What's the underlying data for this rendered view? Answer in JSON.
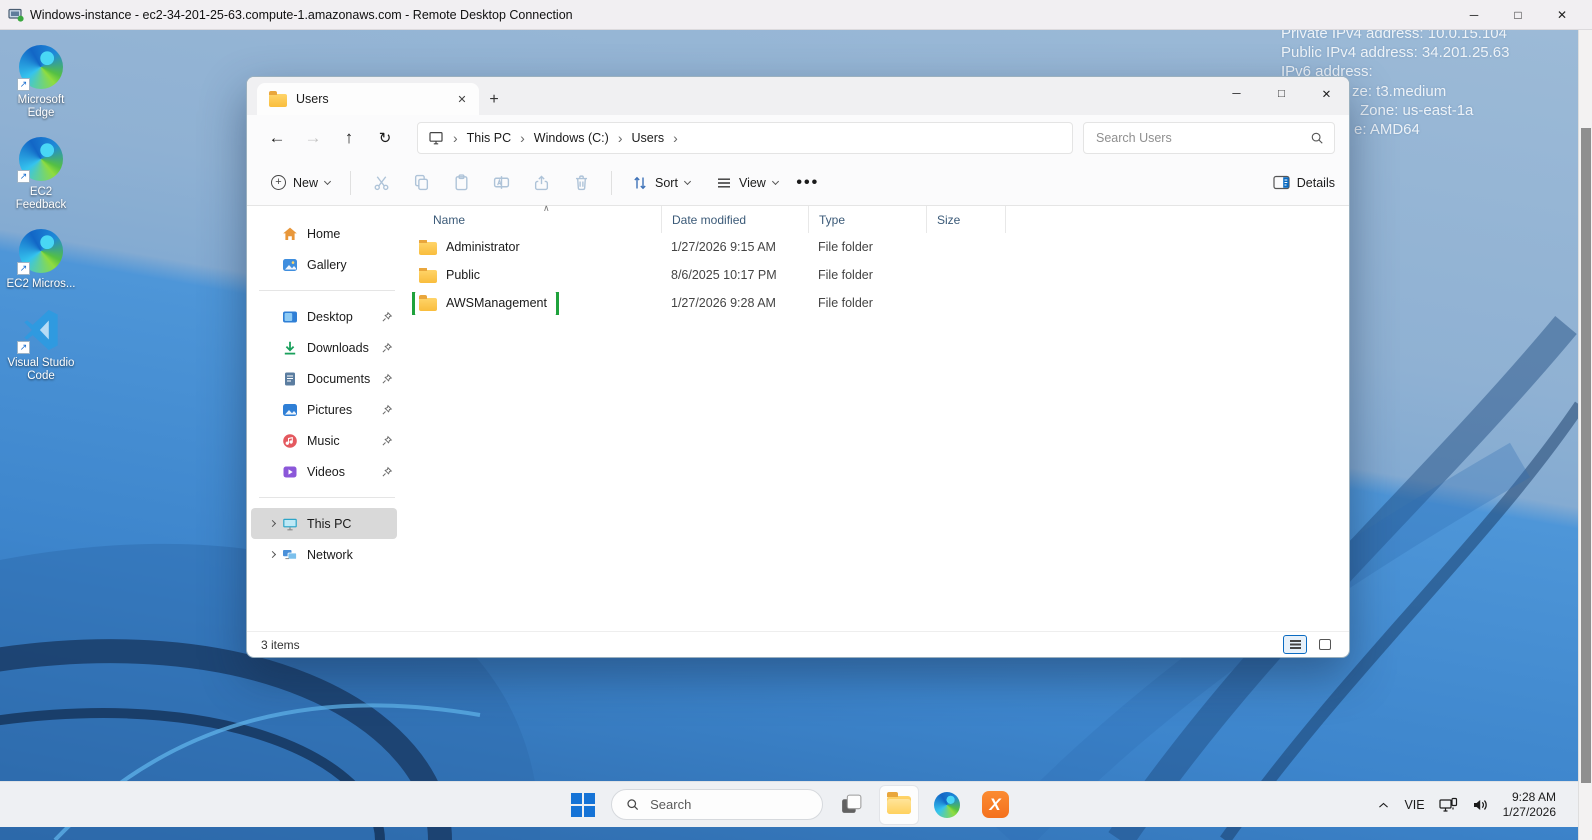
{
  "rdp": {
    "title": "Windows-instance - ec2-34-201-25-63.compute-1.amazonaws.com - Remote Desktop Connection"
  },
  "instance_info": {
    "lines": [
      "Private IPv4 address: 10.0.15.104",
      "Public IPv4 address: 34.201.25.63",
      "IPv6 address:",
      "ze: t3.medium",
      "Zone: us-east-1a",
      "e: AMD64"
    ]
  },
  "desktop_icons": [
    {
      "label": "Microsoft Edge"
    },
    {
      "label": "EC2 Feedback"
    },
    {
      "label": "EC2 Micros..."
    },
    {
      "label": "Visual Studio Code"
    }
  ],
  "explorer": {
    "tab_label": "Users",
    "nav": {
      "breadcrumb": [
        "This PC",
        "Windows (C:)",
        "Users"
      ],
      "search_placeholder": "Search Users"
    },
    "toolbar": {
      "new": "New",
      "sort": "Sort",
      "view": "View",
      "details": "Details"
    },
    "sidebar": {
      "items": [
        {
          "label": "Home"
        },
        {
          "label": "Gallery"
        },
        {
          "label": "Desktop"
        },
        {
          "label": "Downloads"
        },
        {
          "label": "Documents"
        },
        {
          "label": "Pictures"
        },
        {
          "label": "Music"
        },
        {
          "label": "Videos"
        },
        {
          "label": "This PC"
        },
        {
          "label": "Network"
        }
      ]
    },
    "columns": [
      "Name",
      "Date modified",
      "Type",
      "Size"
    ],
    "files": [
      {
        "name": "Administrator",
        "date_modified": "1/27/2026 9:15 AM",
        "type": "File folder",
        "size": ""
      },
      {
        "name": "Public",
        "date_modified": "8/6/2025 10:17 PM",
        "type": "File folder",
        "size": ""
      },
      {
        "name": "AWSManagement",
        "date_modified": "1/27/2026 9:28 AM",
        "type": "File folder",
        "size": "",
        "highlighted": true
      }
    ],
    "status": "3 items",
    "highlight_color": "#1fa23c"
  },
  "taskbar": {
    "search_placeholder": "Search",
    "tray": {
      "lang": "VIE",
      "time": "9:28 AM",
      "date": "1/27/2026"
    }
  }
}
